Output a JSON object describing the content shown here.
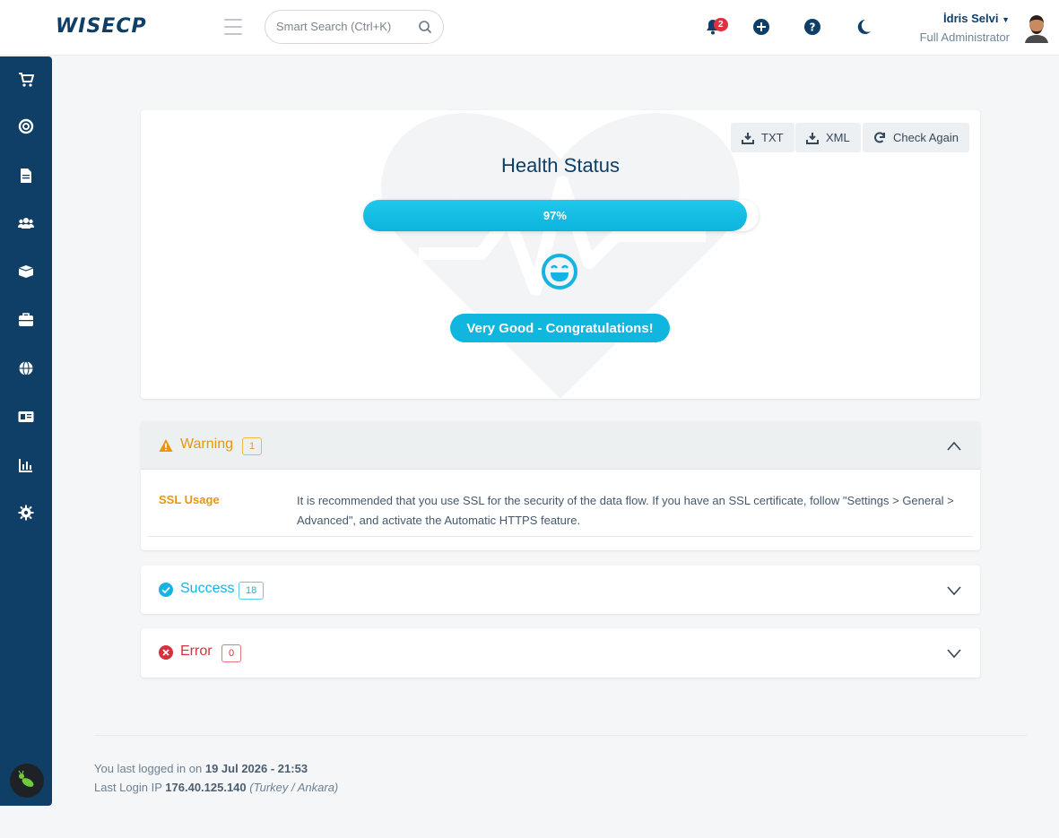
{
  "header": {
    "logo": "WISECP",
    "search_placeholder": "Smart Search (Ctrl+K)",
    "notification_count": "2",
    "user_name": "İdris Selvi",
    "user_role": "Full Administrator"
  },
  "sidebar": {
    "items": [
      "cart-icon",
      "lifebuoy-icon",
      "document-icon",
      "users-icon",
      "box-icon",
      "toolbox-icon",
      "globe-icon",
      "id-card-icon",
      "chart-icon",
      "gear-icon"
    ]
  },
  "health": {
    "buttons": {
      "txt": "TXT",
      "xml": "XML",
      "check_again": "Check Again"
    },
    "title": "Health Status",
    "percent": 97,
    "percent_label": "97%",
    "status": "Very Good - Congratulations!"
  },
  "sections": {
    "warning": {
      "title": "Warning",
      "count": "1",
      "items": [
        {
          "key": "SSL Usage",
          "value": "It is recommended that you use SSL for the security of the data flow. If you have an SSL certificate, follow \"Settings > General > Advanced\", and activate the Automatic HTTPS feature."
        }
      ]
    },
    "success": {
      "title": "Success",
      "count": "18"
    },
    "error": {
      "title": "Error",
      "count": "0"
    }
  },
  "footer": {
    "last_login_prefix": "You last logged in on",
    "last_login_date": "19 Jul 2026 - 21:53",
    "last_ip_prefix": "Last Login IP",
    "last_ip": "176.40.125.140",
    "last_location": "(Turkey / Ankara)"
  },
  "colors": {
    "brand": "#0f3f66",
    "accent": "#13b4e4",
    "warning": "#e9950e",
    "error": "#d6313e"
  }
}
